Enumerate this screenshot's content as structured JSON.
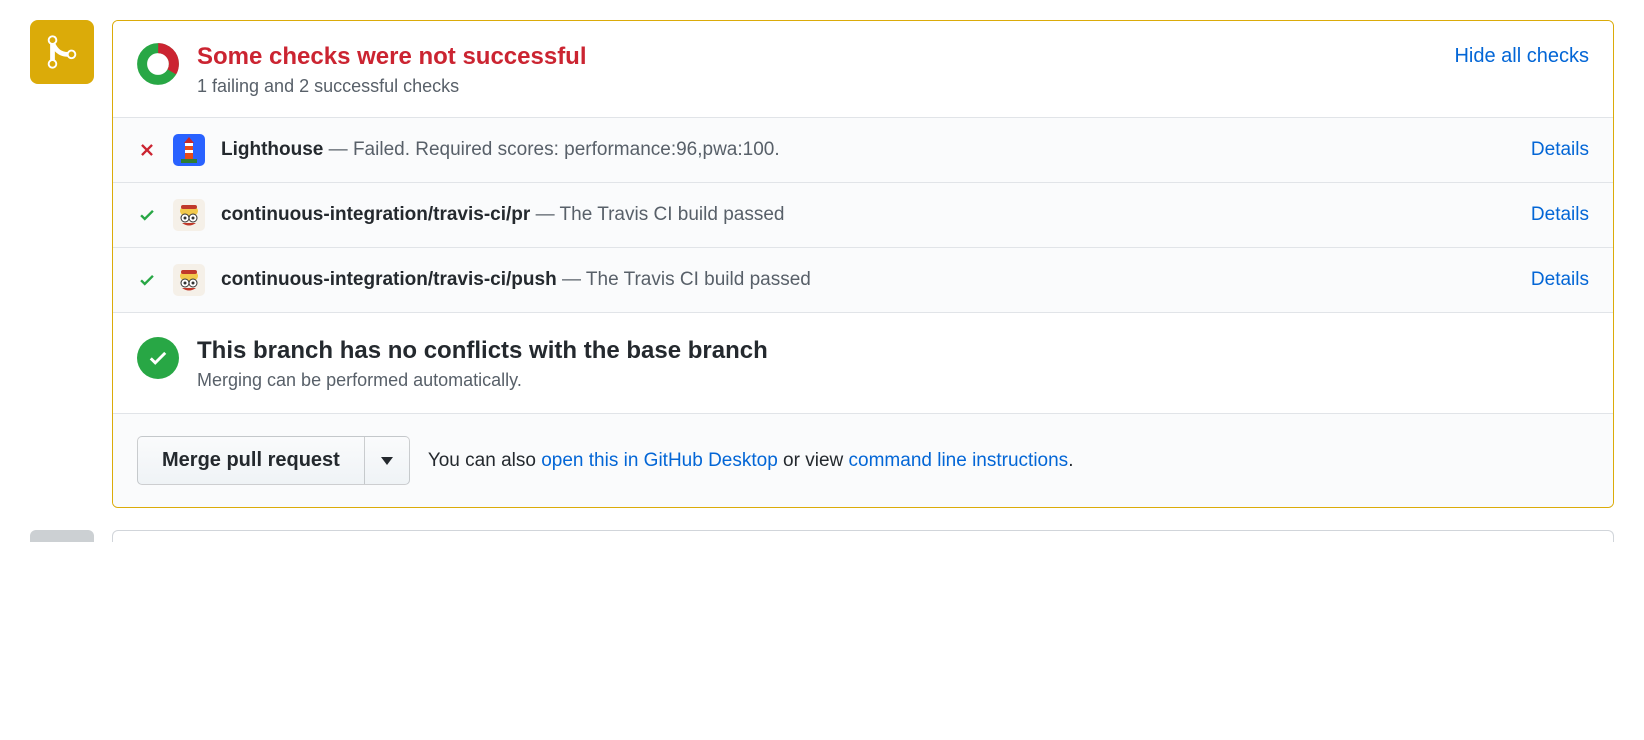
{
  "header": {
    "title": "Some checks were not successful",
    "subtitle": "1 failing and 2 successful checks",
    "hide_link": "Hide all checks"
  },
  "checks": [
    {
      "status": "fail",
      "name": "Lighthouse",
      "dash": " — ",
      "message": "Failed. Required scores: performance:96,pwa:100.",
      "details": "Details",
      "avatar": "lighthouse"
    },
    {
      "status": "pass",
      "name": "continuous-integration/travis-ci/pr",
      "dash": " — ",
      "message": "The Travis CI build passed",
      "details": "Details",
      "avatar": "travis"
    },
    {
      "status": "pass",
      "name": "continuous-integration/travis-ci/push",
      "dash": " — ",
      "message": "The Travis CI build passed",
      "details": "Details",
      "avatar": "travis"
    }
  ],
  "conflict": {
    "title": "This branch has no conflicts with the base branch",
    "subtitle": "Merging can be performed automatically."
  },
  "merge": {
    "button": "Merge pull request",
    "help_prefix": "You can also ",
    "link_desktop": "open this in GitHub Desktop",
    "help_mid": " or view ",
    "link_cli": "command line instructions",
    "help_suffix": "."
  }
}
